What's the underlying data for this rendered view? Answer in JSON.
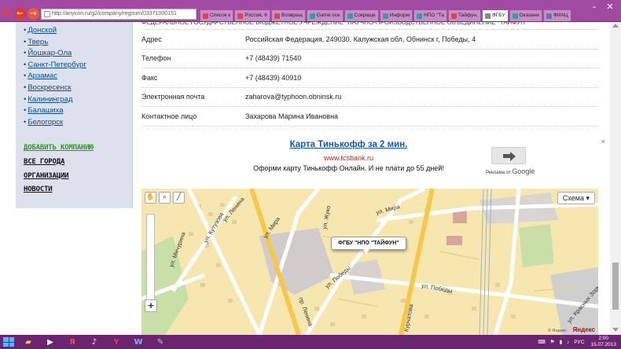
{
  "browser": {
    "url": "http://anycon.ru/g2/company/regnum/03371000151",
    "tabs": [
      {
        "label": "Список к",
        "fav": "red"
      },
      {
        "label": "Россия, К",
        "fav": "red"
      },
      {
        "label": "Возвращ",
        "fav": "red"
      },
      {
        "label": "Game sce",
        "fav": "teal"
      },
      {
        "label": "Сокраще",
        "fav": "teal"
      },
      {
        "label": "Информ",
        "fav": "teal"
      },
      {
        "label": "НПО \"Та",
        "fav": "teal"
      },
      {
        "label": "Тайфун,",
        "fav": "red"
      },
      {
        "label": "ФГБУ",
        "fav": "gray",
        "active": true
      },
      {
        "label": "Оказани",
        "fav": "teal"
      },
      {
        "label": "ФИАЦ",
        "fav": "blue"
      }
    ]
  },
  "sidebar": {
    "cities": [
      "Донской",
      "Тверь",
      "Йошкар-Ола",
      "Санкт-Петербург",
      "Арзамас",
      "Воскресенск",
      "Калининград",
      "Балашиха",
      "Белогорск"
    ],
    "links": {
      "add_company": "ДОБАВИТЬ КОМПАНИЮ",
      "all_cities": "ВСЕ ГОРОДА",
      "organizations": "ОРГАНИЗАЦИИ",
      "news": "НОВОСТИ"
    }
  },
  "info": {
    "top_cut": "ФЕДЕРАЛЬНОЕ ГОСУДАРСТВЕННОЕ БЮДЖЕТНОЕ УЧРЕЖДЕНИЕ \"НАУЧНО-ПРОИЗВОДСТВЕННОЕ ОБЪЕДИНЕНИЕ \"ТАЙФУН\"",
    "rows": [
      {
        "label": "Адрес",
        "value": "Российская Федерация, 249030, Калужская обл, Обнинск г, Победы, 4"
      },
      {
        "label": "Телефон",
        "value": "+7 (48439) 71540"
      },
      {
        "label": "Факс",
        "value": "+7 (48439) 40910"
      },
      {
        "label": "Электронная почта",
        "value": "zaharova@typhoon.obninsk.ru"
      },
      {
        "label": "Контактное лицо",
        "value": "Захарова Марина Ивановна"
      }
    ]
  },
  "ad": {
    "title": "Карта Тинькофф за 2 мин.",
    "url": "www.tcsbank.ru",
    "text": "Оформи карту Тинькофф Онлайн. И не плати до 55 дней!",
    "by_prefix": "Реклама от",
    "by_brand": "Google",
    "close": "✕"
  },
  "map": {
    "scheme_label": "Схема ▾",
    "balloon": "ФГБУ \"НПО \"ТАЙФУН\"",
    "streets": {
      "lenina_top": "ул. Ленина",
      "michurina": "ул. Мичурина",
      "kutuzova": "ул. Кутузова",
      "mira1": "ул. Мира",
      "mira2": "ул. Мира",
      "zhukova": "ул. Жуко",
      "pobedy1": "ул. Победы",
      "pobedy2": "ул. Победы",
      "lenina_bottom": "пр. Ленина",
      "kurchatova": "Курчатова",
      "krasnykh_zor": "ул. Красных Зорь"
    },
    "copyright": "© Яндекс",
    "logo": "Яндекс"
  },
  "taskbar": {
    "lang": "РУС",
    "time": "2:00",
    "date": "15.07.2013"
  }
}
